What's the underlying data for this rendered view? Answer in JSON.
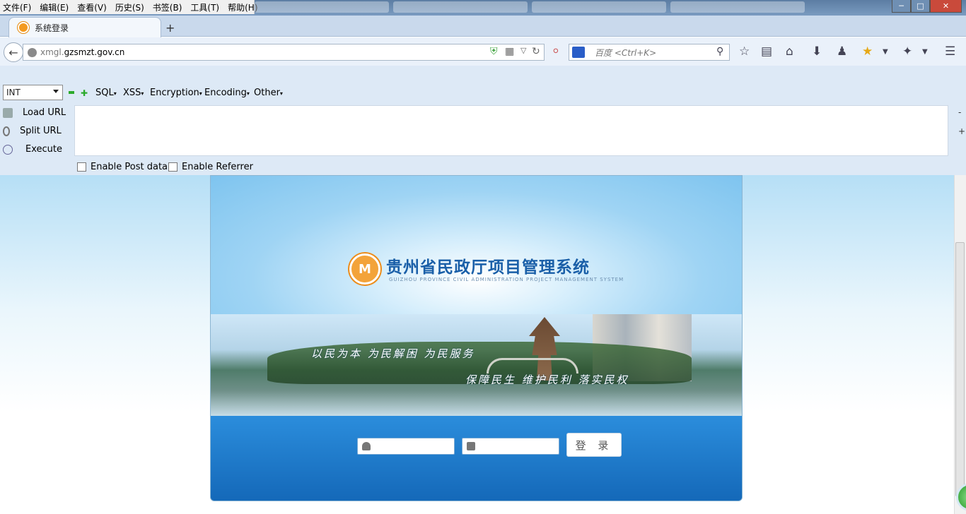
{
  "browser": {
    "menu": [
      "文件(F)",
      "编辑(E)",
      "查看(V)",
      "历史(S)",
      "书签(B)",
      "工具(T)",
      "帮助(H)"
    ],
    "window_controls": {
      "minimize": "─",
      "maximize": "□",
      "close": "✕"
    },
    "active_tab": {
      "title": "系统登录"
    },
    "new_tab_label": "+",
    "url": {
      "subdomain": "xmgl.",
      "domain": "gzsmzt.gov.cn"
    },
    "search": {
      "placeholder": "百度 <Ctrl+K>"
    }
  },
  "hackbar": {
    "type_select": "INT",
    "menus": [
      "SQL",
      "XSS",
      "Encryption",
      "Encoding",
      "Other"
    ],
    "actions": [
      "Load URL",
      "Split URL",
      "Execute"
    ],
    "text_value": "",
    "checkboxes": [
      "Enable Post data",
      "Enable Referrer"
    ],
    "minus_label": "-",
    "plus_label": "+"
  },
  "page": {
    "system_title": "贵州省民政厅项目管理系统",
    "system_subtitle": "GUIZHOU PROVINCE CIVIL ADMINISTRATION PROJECT MANAGEMENT SYSTEM",
    "slogan_top": "以民为本   为民解困   为民服务",
    "slogan_bottom": "保障民生   维护民利   落实民权",
    "login": {
      "username_value": "",
      "password_value": "",
      "button_label": "登 录"
    }
  },
  "icons": [
    "back-arrow-icon",
    "globe-icon",
    "shield-icon",
    "qr-icon",
    "reload-icon",
    "star-icon",
    "reading-list-icon",
    "home-icon",
    "download-icon",
    "user-icon",
    "addon-icon",
    "menu-icon",
    "user-icon",
    "lock-icon"
  ]
}
